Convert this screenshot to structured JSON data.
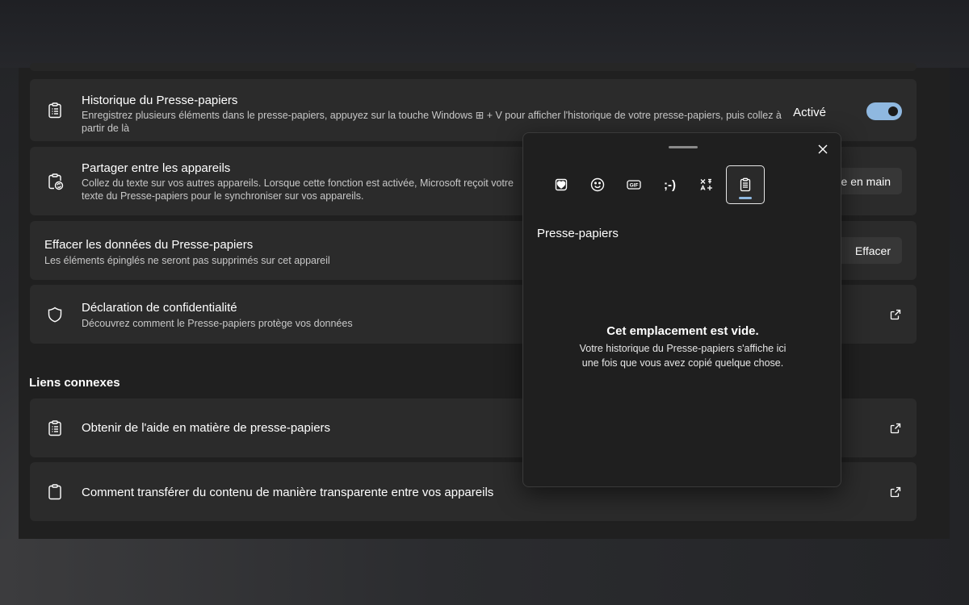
{
  "settings": {
    "clipboard_history": {
      "title": "Historique du Presse-papiers",
      "description": "Enregistrez plusieurs éléments dans le presse-papiers, appuyez sur la touche Windows ⊞ + V pour afficher l'historique de votre presse-papiers, puis collez à partir de là",
      "toggle_label": "Activé",
      "toggle_on": true
    },
    "share_devices": {
      "title": "Partager entre les appareils",
      "description": "Collez du texte sur vos autres appareils. Lorsque cette fonction est activée, Microsoft reçoit votre texte du Presse-papiers pour le synchroniser sur vos appareils.",
      "button_label": "Prise en main"
    },
    "clear_data": {
      "title": "Effacer les données du Presse-papiers",
      "description": "Les éléments épinglés ne seront pas supprimés sur cet appareil",
      "button_label": "Effacer"
    },
    "privacy": {
      "title": "Déclaration de confidentialité",
      "description": "Découvrez comment le Presse-papiers protège vos données"
    },
    "related_links_title": "Liens connexes",
    "related_links": [
      {
        "label": "Obtenir de l'aide en matière de presse-papiers"
      },
      {
        "label": "Comment transférer du contenu de manière transparente entre vos appareils"
      }
    ]
  },
  "popup": {
    "tabs": [
      {
        "name": "favorites",
        "icon": "heart-icon"
      },
      {
        "name": "emoji",
        "icon": "smiley-icon"
      },
      {
        "name": "gif",
        "icon": "gif-icon",
        "label": "GIF"
      },
      {
        "name": "kaomoji",
        "icon": "kaomoji-icon",
        "label": ";-)"
      },
      {
        "name": "symbols",
        "icon": "symbols-icon"
      },
      {
        "name": "clipboard",
        "icon": "clipboard-icon",
        "active": true
      }
    ],
    "heading": "Presse-papiers",
    "empty_title": "Cet emplacement est vide.",
    "empty_body": "Votre historique du Presse-papiers s'affiche ici une fois que vous avez copié quelque chose."
  },
  "colors": {
    "accent": "#8fb8e0",
    "card_bg": "#2b2b2b",
    "page_bg": "#202020",
    "popup_bg": "#1f1f1f"
  }
}
